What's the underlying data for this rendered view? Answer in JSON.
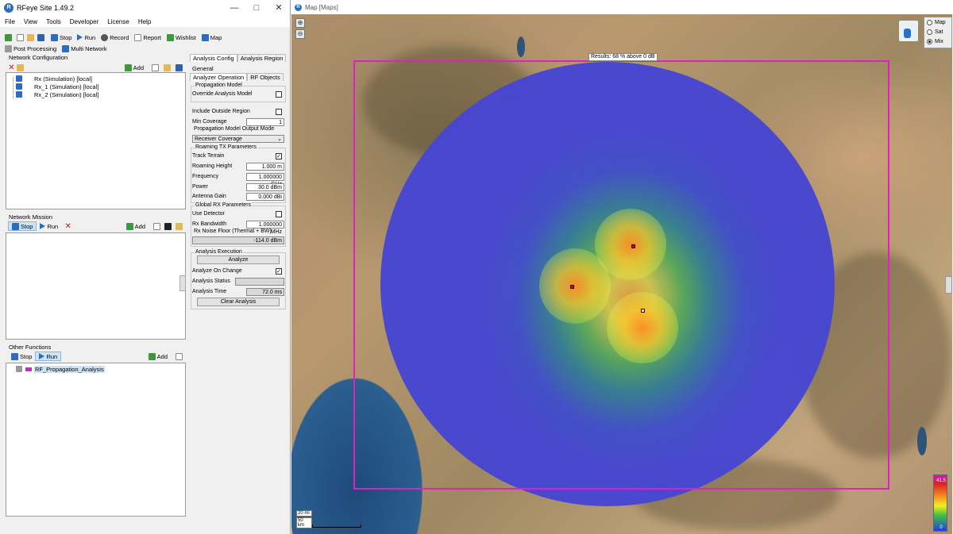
{
  "main": {
    "title": "RFeye Site 1.49.2",
    "menu": [
      "File",
      "View",
      "Tools",
      "Developer",
      "License",
      "Help"
    ],
    "toolbar": {
      "stop": "Stop",
      "run": "Run",
      "record": "Record",
      "report": "Report",
      "wishlist": "Wishlist",
      "map": "Map",
      "post_processing": "Post Processing",
      "multi_network": "Multi Network"
    },
    "network_config": {
      "label": "Network Configuration",
      "add": "Add",
      "items": [
        {
          "label": "Rx (Simulation) [local]",
          "color": "#d0208a"
        },
        {
          "label": "Rx_1 (Simulation) [local]",
          "color": "#e8a020"
        },
        {
          "label": "Rx_2 (Simulation) [local]",
          "color": "#b01870"
        }
      ]
    },
    "network_mission": {
      "label": "Network Mission",
      "stop": "Stop",
      "run": "Run",
      "add": "Add"
    },
    "other_functions": {
      "label": "Other Functions",
      "stop": "Stop",
      "run": "Run",
      "add": "Add",
      "items": [
        {
          "label": "RF_Propagation_Analysis",
          "color": "#c030c0"
        }
      ]
    },
    "props": {
      "tabs_top": [
        "Analysis Config",
        "Analysis Region"
      ],
      "general": "General",
      "tabs_bottom": [
        "Analyzer Operation",
        "RF Objects"
      ],
      "propagation_model": "Propagation Model",
      "override_model": "Override Analysis Model",
      "include_outside": "Include Outside Region",
      "min_coverage": {
        "label": "Min Coverage",
        "value": "1"
      },
      "output_mode_label": "Propagation Model Output Mode",
      "output_mode_value": "Receiver Coverage",
      "roaming_tx": "Roaming TX Parameters",
      "track_terrain": "Track Terrain",
      "roaming_height": {
        "label": "Roaming Height",
        "value": "1.000 m"
      },
      "frequency": {
        "label": "Frequency",
        "value": "1.000000 GHz"
      },
      "power": {
        "label": "Power",
        "value": "30.0 dBm"
      },
      "antenna_gain": {
        "label": "Antenna Gain",
        "value": "0.000 dBi"
      },
      "global_rx": "Global RX Parameters",
      "use_detector": "Use Detector",
      "rx_bandwidth": {
        "label": "Rx Bandwidth",
        "value": "1.000000 MHz"
      },
      "noise_floor": {
        "label": "Rx Noise Floor (Thermal + BW)",
        "value": "-114.0 dBm"
      },
      "analysis_execution": "Analysis Execution",
      "analyze_btn": "Analyze",
      "analyze_on_change": "Analyze On Change",
      "analysis_status": "Analysis Status",
      "analysis_time": {
        "label": "Analysis Time",
        "value": "72.0 ms"
      },
      "clear_btn": "Clear Analysis"
    }
  },
  "map": {
    "title": "Map [Maps]",
    "result": "Results: 68 % above 0 dB",
    "layers": [
      "Map",
      "Sat",
      "Mix"
    ],
    "selected_layer": "Mix",
    "scale_top": "20 mi",
    "scale_bottom": "50 km",
    "legend_max": "41.5",
    "legend_min": "0"
  }
}
